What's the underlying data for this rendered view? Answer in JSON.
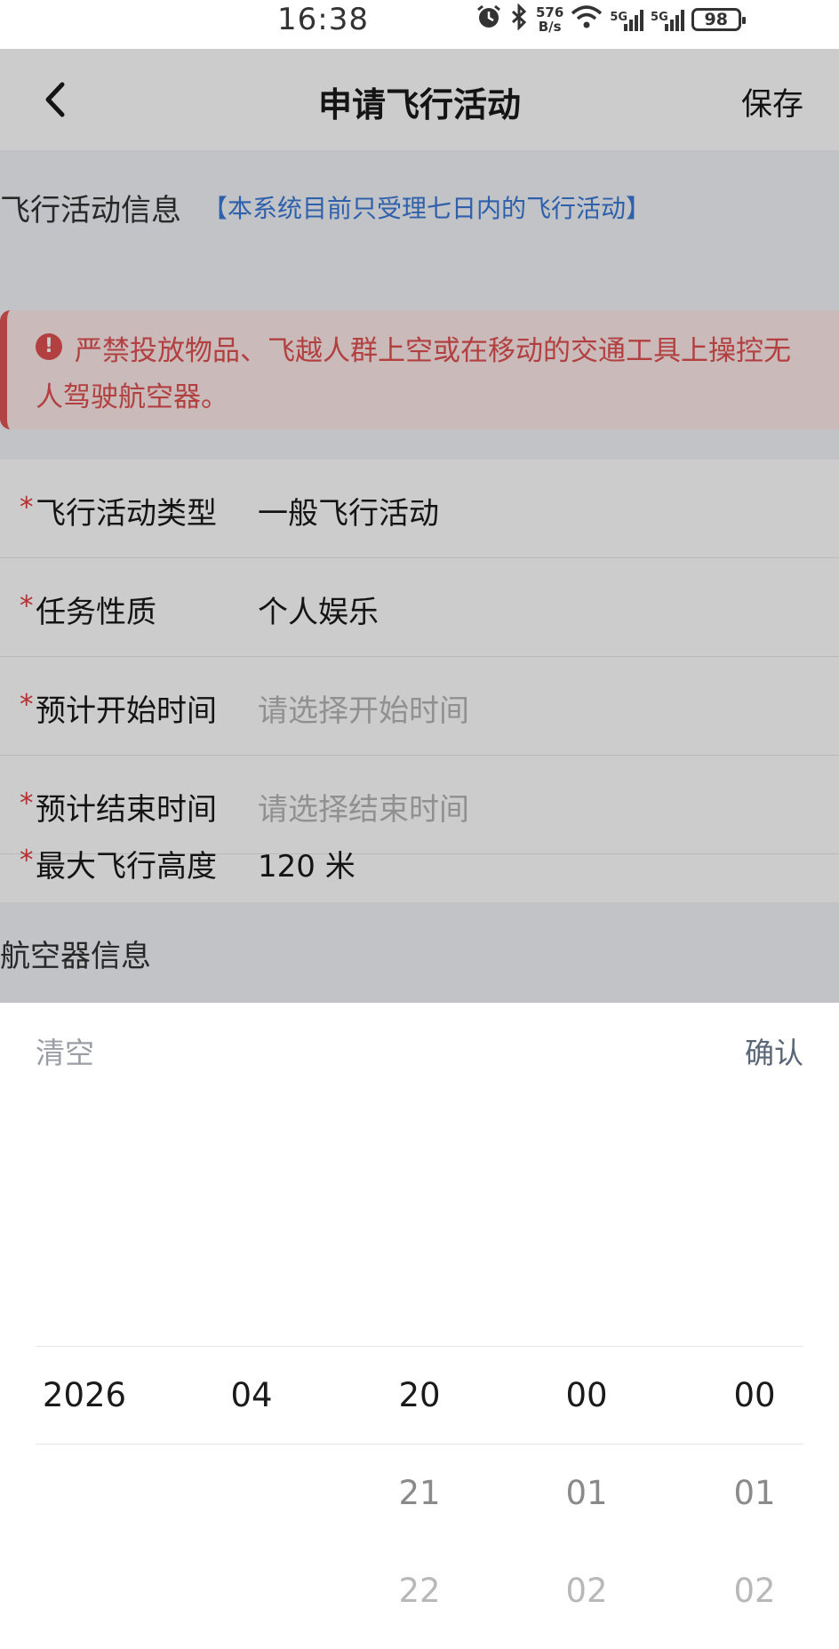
{
  "status_bar": {
    "time": "16:38",
    "net_speed_value": "576",
    "net_speed_unit": "B/s",
    "sim1_label": "5G",
    "sim2_label": "5G",
    "battery": "98",
    "icons": [
      "alarm-icon",
      "bluetooth-icon",
      "wifi-icon",
      "signal-icon",
      "battery-icon"
    ]
  },
  "nav": {
    "title": "申请飞行活动",
    "save_label": "保存"
  },
  "flight_info": {
    "title": "飞行活动信息",
    "note": "【本系统目前只受理七日内的飞行活动】",
    "alert_icon": "!",
    "alert_text": "严禁投放物品、飞越人群上空或在移动的交通工具上操控无人驾驶航空器。"
  },
  "form": {
    "required_mark": "*",
    "rows": [
      {
        "label": "飞行活动类型",
        "value": "一般飞行活动",
        "placeholder": false
      },
      {
        "label": "任务性质",
        "value": "个人娱乐",
        "placeholder": false
      },
      {
        "label": "预计开始时间",
        "value": "请选择开始时间",
        "placeholder": true
      },
      {
        "label": "预计结束时间",
        "value": "请选择结束时间",
        "placeholder": true
      },
      {
        "label": "最大飞行高度",
        "value": "120 米",
        "placeholder": false
      }
    ]
  },
  "aircraft_info": {
    "title": "航空器信息"
  },
  "picker": {
    "clear_label": "清空",
    "confirm_label": "确认",
    "columns": [
      {
        "selected": "2026",
        "next1": "",
        "next2": ""
      },
      {
        "selected": "04",
        "next1": "",
        "next2": ""
      },
      {
        "selected": "20",
        "next1": "21",
        "next2": "22"
      },
      {
        "selected": "00",
        "next1": "01",
        "next2": "02"
      },
      {
        "selected": "00",
        "next1": "01",
        "next2": "02"
      }
    ]
  },
  "colors": {
    "accent_blue": "#3a78d6",
    "alert_red": "#e05050",
    "required_red": "#e23c3c",
    "placeholder_gray": "#b5b5b5"
  }
}
